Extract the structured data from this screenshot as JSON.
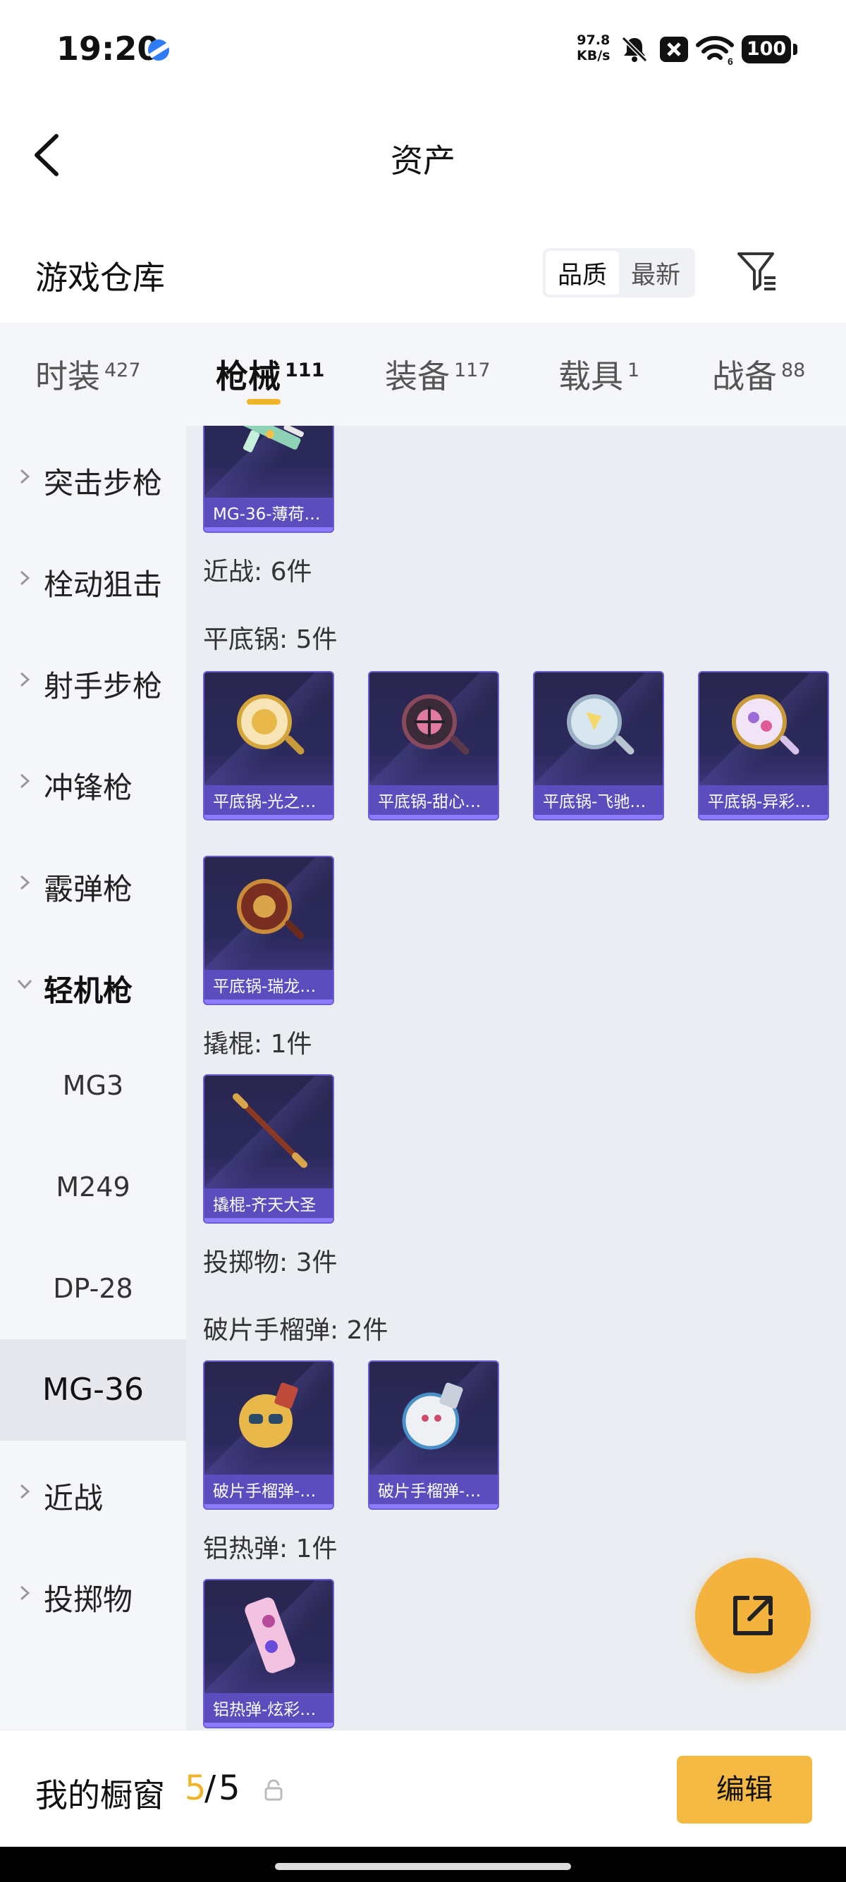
{
  "status_bar": {
    "time": "19:20",
    "net_speed_value": "97.8",
    "net_speed_unit": "KB/s",
    "battery": "100",
    "wifi_sub": "6"
  },
  "header": {
    "title": "资产"
  },
  "section": {
    "title": "游戏仓库",
    "sort_options": [
      "品质",
      "最新"
    ],
    "sort_selected": "品质"
  },
  "tabs": [
    {
      "label": "时装",
      "count": "427"
    },
    {
      "label": "枪械",
      "count": "111",
      "active": true
    },
    {
      "label": "装备",
      "count": "117"
    },
    {
      "label": "载具",
      "count": "1"
    },
    {
      "label": "战备",
      "count": "88"
    }
  ],
  "sidebar": {
    "items": [
      "突击步枪",
      "栓动狙击",
      "射手步枪",
      "冲锋枪",
      "霰弹枪",
      "轻机枪"
    ],
    "sub_items": [
      "MG3",
      "M249",
      "DP-28",
      "MG-36"
    ],
    "selected": "MG-36",
    "items_after": [
      "近战",
      "投掷物"
    ]
  },
  "content": {
    "top_card": "MG-36-薄荷…",
    "melee_header": "近战: 6件",
    "pan_header": "平底锅: 5件",
    "pan_cards": [
      "平底锅-光之…",
      "平底锅-甜心…",
      "平底锅-飞驰…",
      "平底锅-异彩…",
      "平底锅-瑞龙…"
    ],
    "crowbar_header": "撬棍: 1件",
    "crowbar_cards": [
      "撬棍-齐天大圣"
    ],
    "throwables_header": "投掷物: 3件",
    "frag_header": "破片手榴弹: 2件",
    "frag_cards": [
      "破片手榴弹-…",
      "破片手榴弹-…"
    ],
    "thermite_header": "铝热弹: 1件",
    "thermite_cards": [
      "铝热弹-炫彩…"
    ]
  },
  "bottom": {
    "window_label": "我的橱窗",
    "window_current": "5",
    "window_sep": "/",
    "window_total": "5",
    "edit_label": "编辑"
  },
  "colors": {
    "accent": "#f0b429",
    "card_bg": "#2c2a5c",
    "card_caption": "#5b4dbd"
  }
}
